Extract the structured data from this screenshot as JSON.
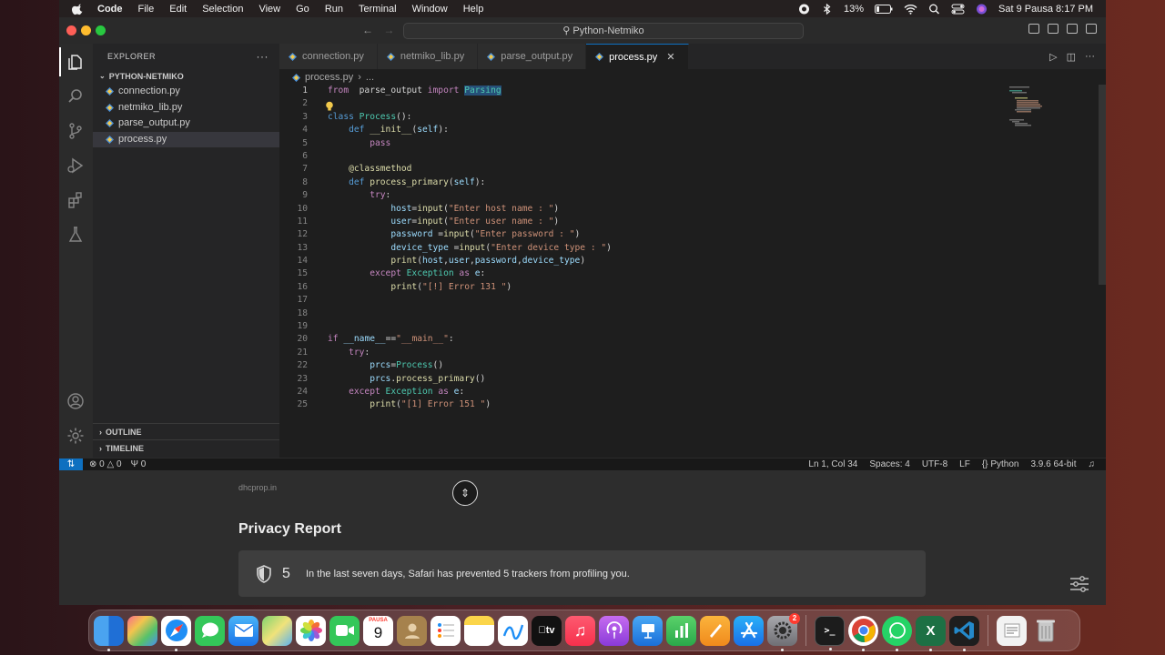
{
  "menubar": {
    "app_name": "Code",
    "menus": [
      "File",
      "Edit",
      "Selection",
      "View",
      "Go",
      "Run",
      "Terminal",
      "Window",
      "Help"
    ],
    "battery": "13%",
    "datetime": "Sat 9 Pausa  8:17 PM"
  },
  "window": {
    "title": "Python-Netmiko"
  },
  "sidebar": {
    "header": "EXPLORER",
    "folder": "PYTHON-NETMIKO",
    "files": [
      "connection.py",
      "netmiko_lib.py",
      "parse_output.py",
      "process.py"
    ],
    "selected": "process.py",
    "outline": "OUTLINE",
    "timeline": "TIMELINE"
  },
  "tabs": [
    {
      "label": "connection.py"
    },
    {
      "label": "netmiko_lib.py"
    },
    {
      "label": "parse_output.py"
    },
    {
      "label": "process.py",
      "active": true
    }
  ],
  "breadcrumb": {
    "file": "process.py",
    "rest": "..."
  },
  "status": {
    "errors": "0",
    "warnings": "0",
    "ports": "0",
    "position": "Ln 1, Col 34",
    "spaces": "Spaces: 4",
    "encoding": "UTF-8",
    "eol": "LF",
    "language": "Python",
    "interpreter": "3.9.6 64-bit"
  },
  "safari": {
    "domain": "dhcprop.in",
    "title": "Privacy Report",
    "tracker_count": "5",
    "message": "In the last seven days, Safari has prevented 5 trackers from profiling you."
  },
  "dock": {
    "calendar_month": "PAUSA",
    "calendar_day": "9",
    "settings_badge": "2"
  },
  "colors": {
    "accent": "#0e70c0",
    "editor_bg": "#1e1e1e",
    "sidebar_bg": "#252526"
  }
}
